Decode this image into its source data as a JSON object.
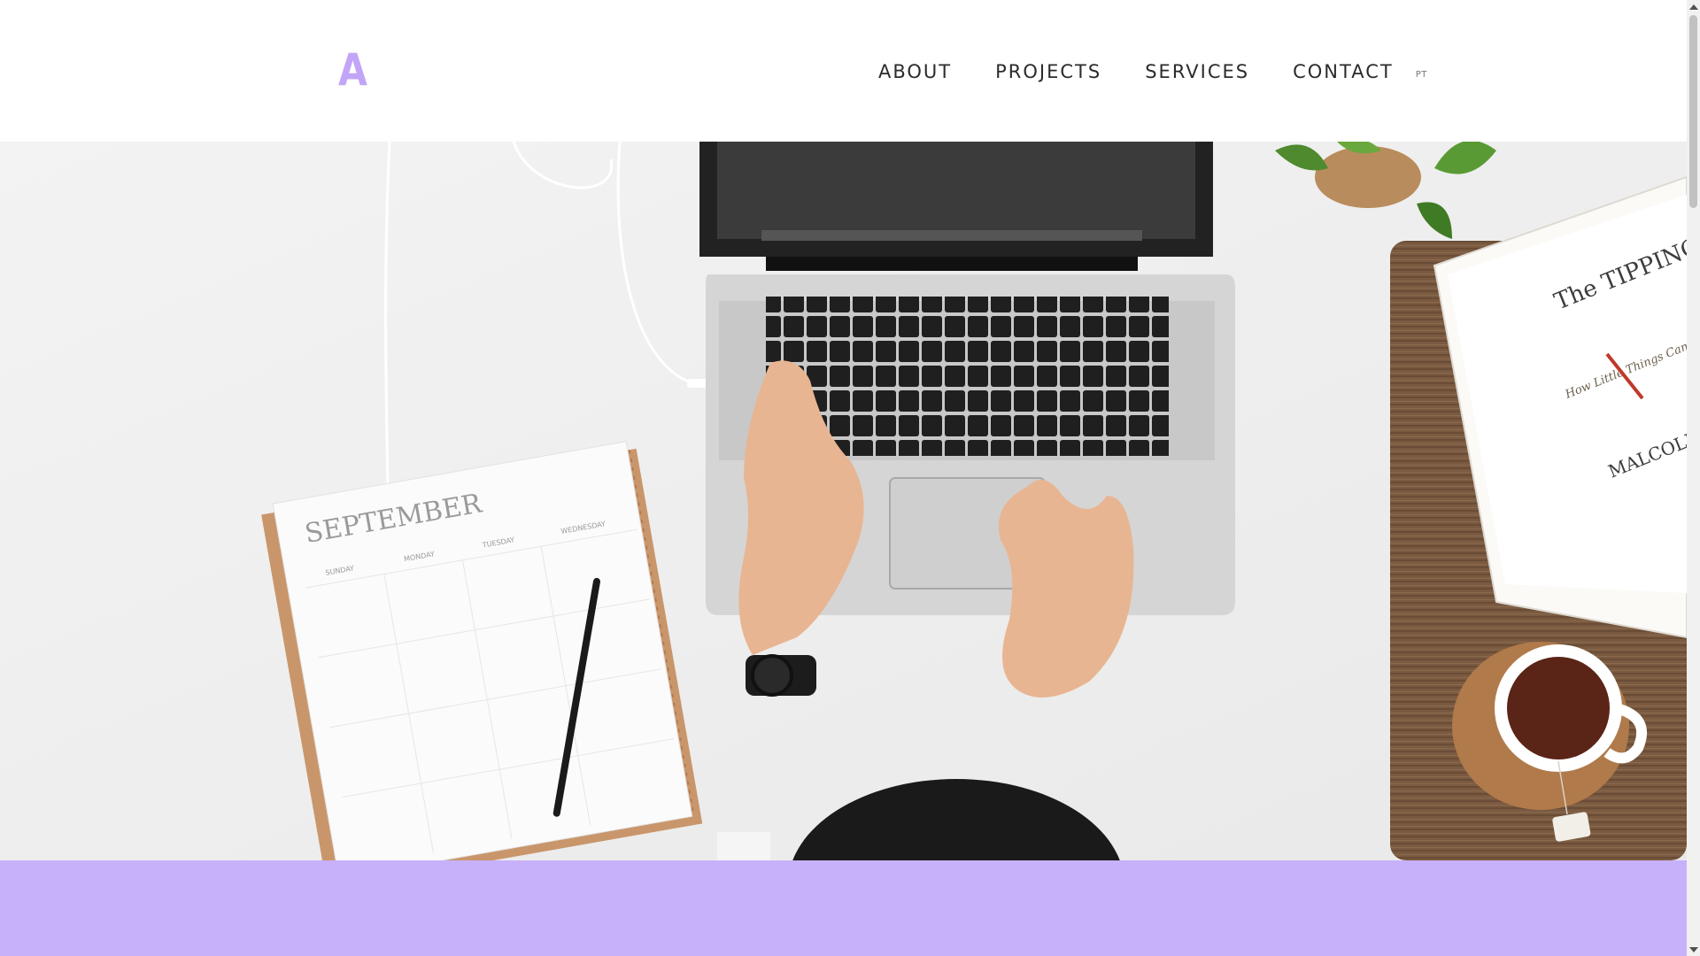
{
  "header": {
    "logo": "A",
    "nav": [
      {
        "label": "ABOUT"
      },
      {
        "label": "PROJECTS"
      },
      {
        "label": "SERVICES"
      },
      {
        "label": "CONTACT"
      }
    ],
    "language": "PT"
  },
  "hero": {
    "calendar_month": "SEPTEMBER",
    "calendar_days": [
      "SUNDAY",
      "MONDAY",
      "TUESDAY",
      "WEDNESDAY"
    ],
    "book_title": "The TIPPING POINT",
    "book_subtitle": "How Little Things Can Make a Big Difference",
    "book_author": "MALCOLM GLADWELL"
  },
  "colors": {
    "accent": "#c3a5f8",
    "band": "#c7b1fb",
    "nav_text": "#2b2b2b"
  }
}
